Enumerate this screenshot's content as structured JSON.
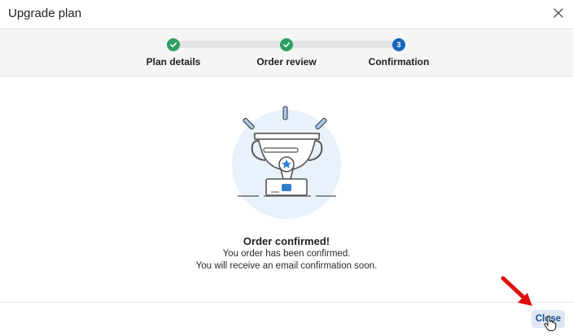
{
  "dialog": {
    "title": "Upgrade plan",
    "close_icon": "close-icon"
  },
  "stepper": {
    "steps": [
      {
        "label": "Plan details",
        "status": "completed",
        "icon": "check-icon"
      },
      {
        "label": "Order review",
        "status": "completed",
        "icon": "check-icon"
      },
      {
        "label": "Confirmation",
        "status": "current",
        "number": "3"
      }
    ]
  },
  "message": {
    "illustration": "trophy-icon",
    "title": "Order confirmed!",
    "line1": "You order has been confirmed.",
    "line2": "You will receive an email confirmation soon."
  },
  "footer": {
    "close_label": "Close"
  },
  "colors": {
    "completed": "#2e9e62",
    "current": "#1565c0",
    "button_bg": "#dde7f3",
    "button_text": "#1a4f8a",
    "annotation_arrow": "#e01010"
  }
}
